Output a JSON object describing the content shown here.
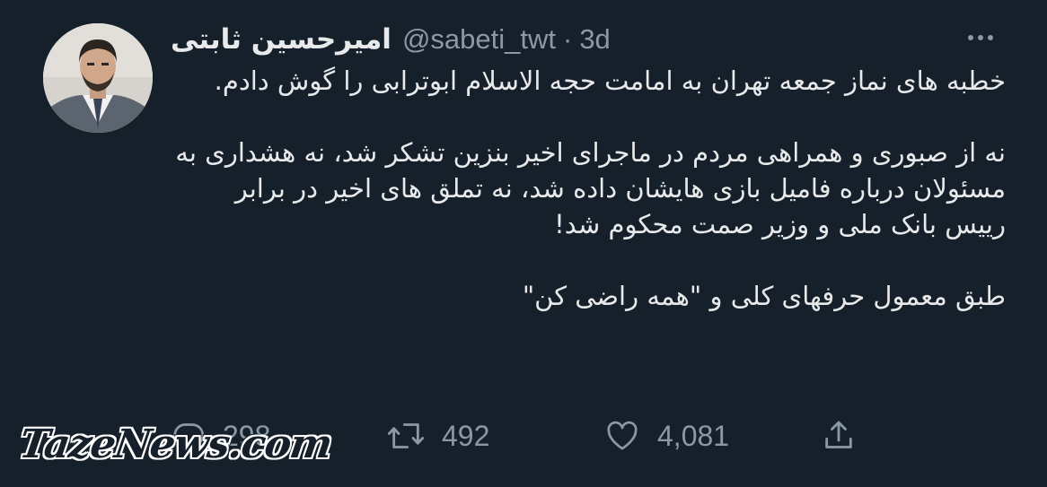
{
  "tweet": {
    "display_name": "امیرحسین ثابتی",
    "handle": "@sabeti_twt",
    "separator": "·",
    "time": "3d",
    "paragraphs": [
      "خطبه های نماز جمعه تهران به امامت حجه الاسلام ابوترابی را گوش دادم.",
      "نه از صبوری و همراهی مردم در ماجرای اخیر بنزین تشکر شد، نه هشداری به مسئولان درباره فامیل بازی هایشان داده شد، نه تملق های اخیر در برابر رییس بانک ملی و وزیر صمت محکوم شد!",
      "طبق معمول حرفهای کلی و \"همه راضی کن\""
    ]
  },
  "actions": {
    "reply_count": "298",
    "retweet_count": "492",
    "like_count": "4,081"
  },
  "watermark": "TazeNews.com",
  "colors": {
    "background": "#16202b",
    "text": "#e7e9ea",
    "secondary": "#8b98a5"
  },
  "icons": {
    "more": "more-horizontal-icon",
    "reply": "reply-bubble-icon",
    "retweet": "retweet-icon",
    "like": "heart-icon",
    "share": "share-upload-icon"
  }
}
